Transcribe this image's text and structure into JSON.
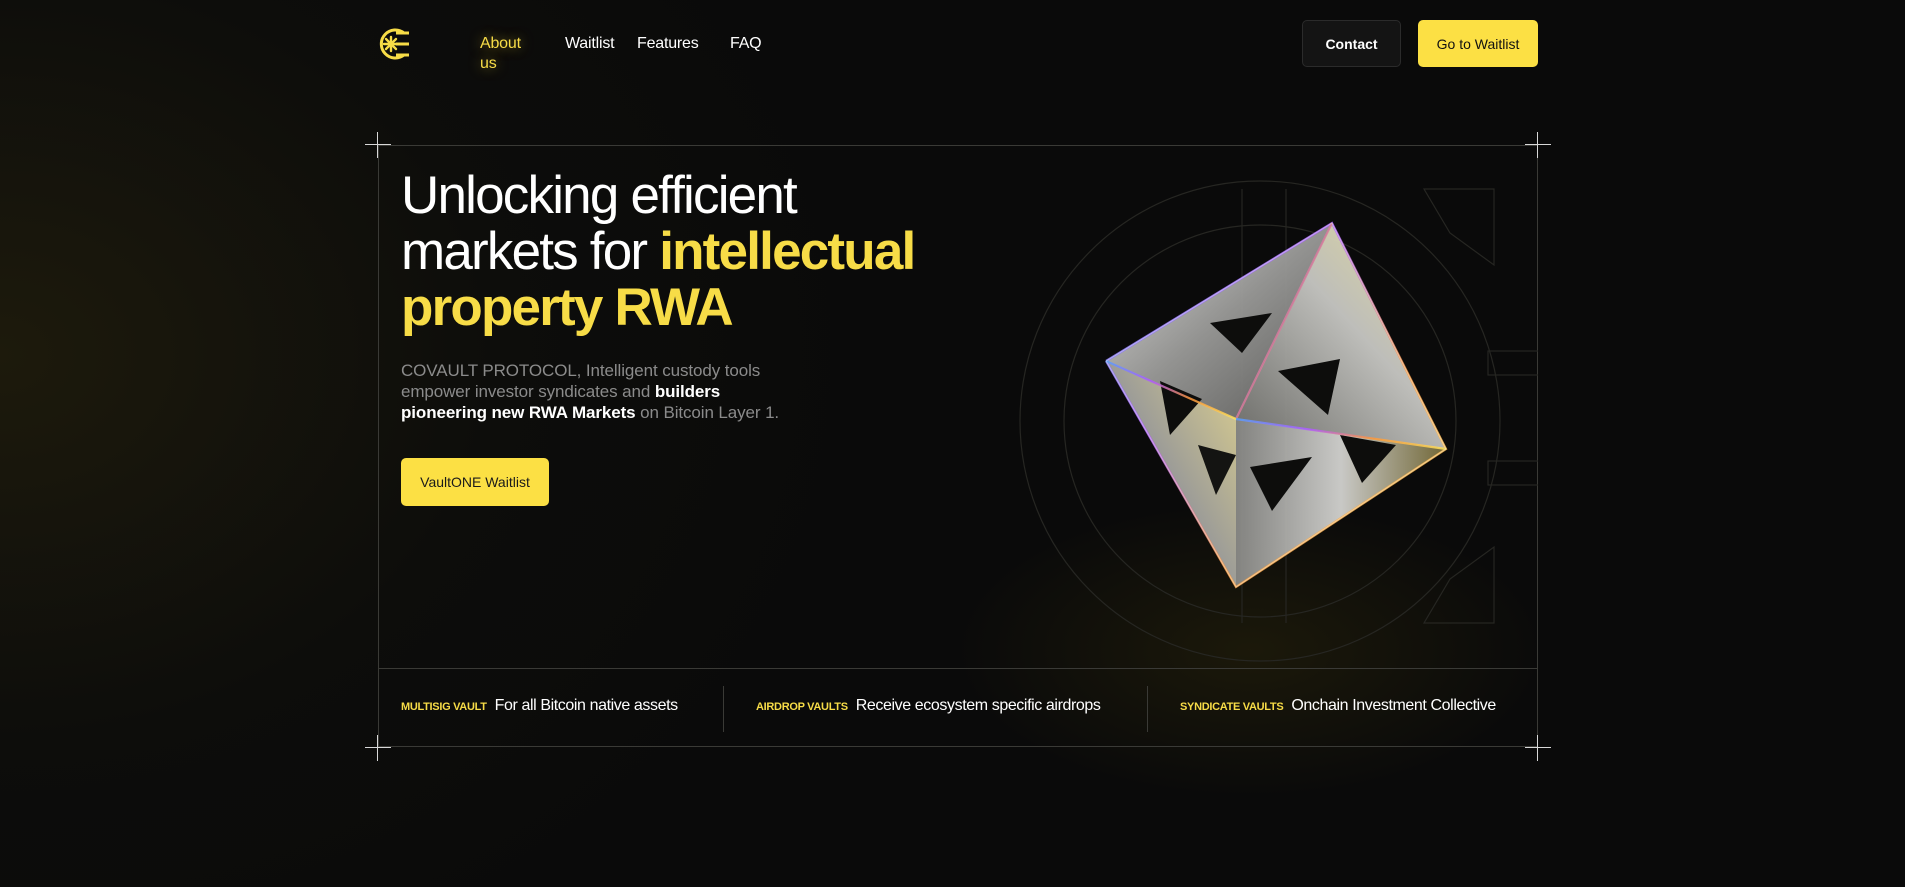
{
  "nav": {
    "logo": "covault-logo",
    "links": [
      {
        "label": "About us",
        "active": true
      },
      {
        "label": "Waitlist",
        "active": false
      },
      {
        "label": "Features",
        "active": false
      },
      {
        "label": "FAQ",
        "active": false
      }
    ],
    "contact_label": "Contact",
    "waitlist_label": "Go to Waitlist"
  },
  "hero": {
    "title_line1": "Unlocking efficient",
    "title_line2_plain": "markets for ",
    "title_line2_highlight": "intellectual",
    "title_line3_highlight": "property RWA",
    "subtitle_part1": "COVAULT PROTOCOL, Intelligent custody tools empower investor syndicates and ",
    "subtitle_bold": "builders pioneering new RWA Markets",
    "subtitle_part2": " on Bitcoin Layer 1.",
    "cta_label": "VaultONE Waitlist",
    "art": "prism-crystal-graphic"
  },
  "features": [
    {
      "tag": "MULTISIG VAULT",
      "desc": "For all Bitcoin native assets"
    },
    {
      "tag": "AIRDROP VAULTS",
      "desc": "Receive ecosystem specific airdrops"
    },
    {
      "tag": "SYNDICATE VAULTS",
      "desc": "Onchain Investment Collective"
    }
  ],
  "colors": {
    "accent": "#fce044",
    "background": "#0b0b0a",
    "muted_text": "#8b8b8b",
    "border": "#3a3a36"
  }
}
